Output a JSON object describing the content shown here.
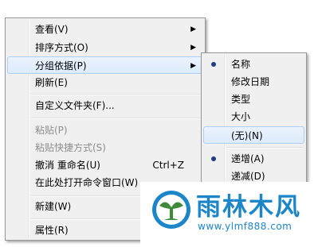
{
  "main_menu": {
    "items": [
      {
        "label": "查看(V)"
      },
      {
        "label": "排序方式(O)"
      },
      {
        "label": "分组依据(P)"
      },
      {
        "label": "刷新(E)"
      },
      {
        "label": "自定义文件夹(F)..."
      },
      {
        "label": "粘贴(P)"
      },
      {
        "label": "粘贴快捷方式(S)"
      },
      {
        "label": "撤消 重命名(U)",
        "accel": "Ctrl+Z"
      },
      {
        "label": "在此处打开命令窗口(W)"
      },
      {
        "label": "新建(W)"
      },
      {
        "label": "属性(R)"
      }
    ],
    "submenu_arrow": "▶"
  },
  "sub_menu": {
    "items": [
      {
        "label": "名称",
        "checked": true
      },
      {
        "label": "修改日期"
      },
      {
        "label": "类型"
      },
      {
        "label": "大小"
      },
      {
        "label": "(无)(N)"
      },
      {
        "label": "递增(A)",
        "checked": true
      },
      {
        "label": "递减(D)"
      }
    ]
  },
  "watermark": {
    "title": "雨林木风",
    "url": "www.ylmf888.com"
  },
  "colors": {
    "menu_bg": "#f0f0f0",
    "highlight": "#dcebfc",
    "highlight_border": "#aecff7",
    "disabled_text": "#8d8d8d",
    "watermark_blue": "#1d86c9",
    "logo_green": "#3d8a3a"
  },
  "icons": [
    "submenu-arrow-icon",
    "radio-dot-icon",
    "tree-logo-icon"
  ]
}
